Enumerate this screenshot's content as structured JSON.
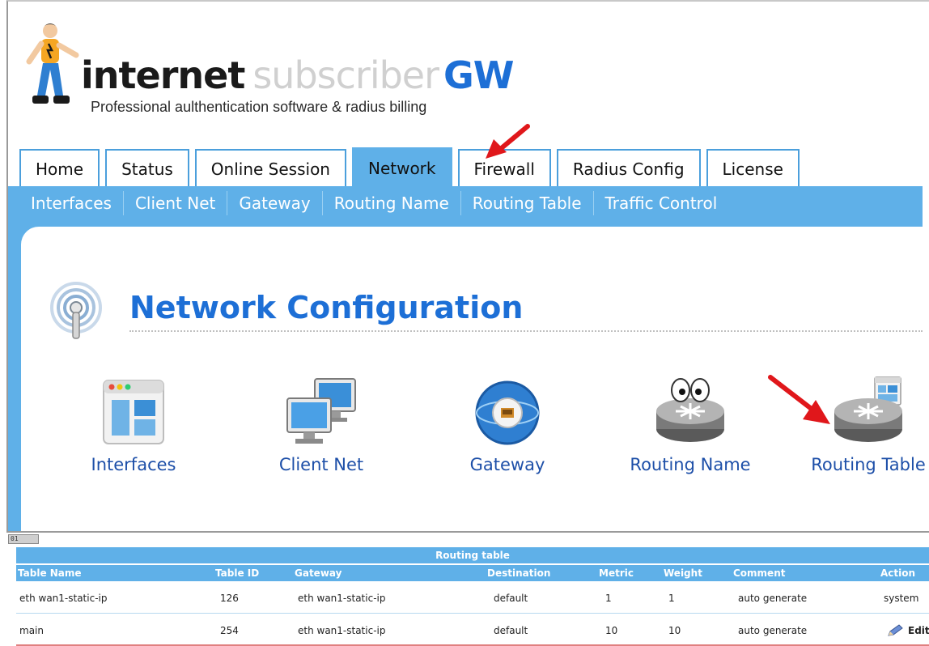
{
  "logo": {
    "word1": "internet",
    "word2": "subscriber",
    "word3": "GW",
    "tagline": "Professional aulthentication software & radius billing"
  },
  "tabs": [
    {
      "label": "Home",
      "active": false
    },
    {
      "label": "Status",
      "active": false
    },
    {
      "label": "Online Session",
      "active": false
    },
    {
      "label": "Network",
      "active": true
    },
    {
      "label": "Firewall",
      "active": false
    },
    {
      "label": "Radius Config",
      "active": false
    },
    {
      "label": "License",
      "active": false
    }
  ],
  "subnav": [
    "Interfaces",
    "Client Net",
    "Gateway",
    "Routing Name",
    "Routing Table",
    "Traffic Control"
  ],
  "page": {
    "title": "Network Configuration",
    "items": [
      {
        "label": "Interfaces",
        "icon": "window-layout-icon"
      },
      {
        "label": "Client Net",
        "icon": "computers-icon"
      },
      {
        "label": "Gateway",
        "icon": "globe-port-icon"
      },
      {
        "label": "Routing Name",
        "icon": "router-eyes-icon"
      },
      {
        "label": "Routing Table",
        "icon": "router-table-icon"
      }
    ]
  },
  "routing_table": {
    "badge": "01",
    "title": "Routing table",
    "columns": [
      "Table Name",
      "Table ID",
      "Gateway",
      "Destination",
      "Metric",
      "Weight",
      "Comment",
      "Action"
    ],
    "rows": [
      [
        "eth wan1-static-ip",
        "126",
        "eth wan1-static-ip",
        "default",
        "1",
        "1",
        "auto generate",
        "system"
      ],
      [
        "main",
        "254",
        "eth wan1-static-ip",
        "default",
        "10",
        "10",
        "auto generate",
        "Edit"
      ]
    ]
  },
  "colors": {
    "accent": "#5fb0e8",
    "title_blue": "#1d6fd6",
    "link_blue": "#1d4fa8",
    "arrow_red": "#e0171b"
  }
}
